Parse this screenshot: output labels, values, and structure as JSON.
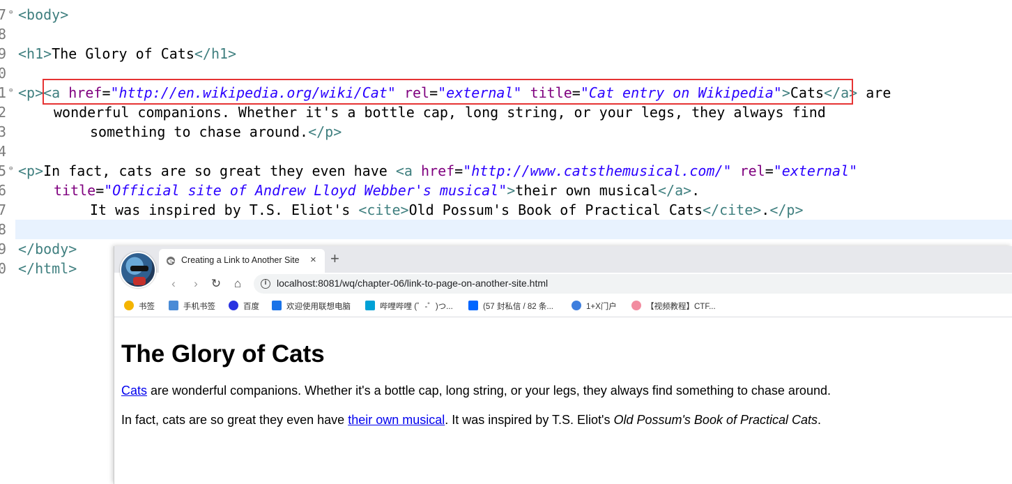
{
  "editor": {
    "gutter": [
      "7",
      "8",
      "9",
      "0",
      "1",
      "2",
      "3",
      "4",
      "5",
      "6",
      "7",
      "8",
      "9",
      "0"
    ],
    "line7": {
      "open": "<",
      "tag": "body",
      "close": ">"
    },
    "line9": {
      "open": "<h1>",
      "text": "The Glory of Cats",
      "close": "</h1>"
    },
    "line11": {
      "p_open": "<p>",
      "a_open": "<a",
      "attr_href": "href",
      "eq": "=",
      "val_href": "\"http://en.wikipedia.org/wiki/Cat\"",
      "attr_rel": "rel",
      "val_rel": "\"external\"",
      "attr_title": "title",
      "val_title": "\"Cat entry on Wikipedia\"",
      "gt": ">",
      "link_text": "Cats",
      "a_close": "</a>",
      "after": " are"
    },
    "line12": "wonderful companions. Whether it's a bottle cap, long string, or your legs, they always find",
    "line13": {
      "text": "something to chase around.",
      "close": "</p>"
    },
    "line15": {
      "p_open": "<p>",
      "text": "In fact, cats are so great they even have ",
      "a_open": "<a",
      "attr_href": "href",
      "val_href": "\"http://www.catsthemusical.com/\"",
      "attr_rel": "rel",
      "val_rel": "\"external\""
    },
    "line16": {
      "attr_title": "title",
      "val_title": "\"Official site of Andrew Lloyd Webber's musical\"",
      "gt": ">",
      "link_text": "their own musical",
      "a_close": "</a>",
      "after": "."
    },
    "line17": {
      "text": "It was inspired by T.S. Eliot's ",
      "cite_open": "<cite>",
      "cite_text": "Old Possum's Book of Practical Cats",
      "cite_close": "</cite>",
      "dot": ".",
      "p_close": "</p>"
    },
    "line19": "</body>",
    "line20": "</html>"
  },
  "browser": {
    "tab_title": "Creating a Link to Another Site",
    "tab_close": "×",
    "new_tab": "+",
    "nav": {
      "back": "‹",
      "forward": "›",
      "reload": "↻",
      "home": "⌂"
    },
    "url": "localhost:8081/wq/chapter-06/link-to-page-on-another-site.html",
    "bookmarks": [
      {
        "label": "书签",
        "icon": "star-icon",
        "color": "#f4b400"
      },
      {
        "label": "手机书签",
        "icon": "phone-bookmark-icon",
        "color": "#4a8bd6"
      },
      {
        "label": "百度",
        "icon": "baidu-paw-icon",
        "color": "#2932e1"
      },
      {
        "label": "欢迎使用联想电脑",
        "icon": "lenovo-icon",
        "color": "#1a73e8"
      },
      {
        "label": "哔哩哔哩 (゜-゜)つ...",
        "icon": "bilibili-icon",
        "color": "#00a1d6"
      },
      {
        "label": "(57 封私信 / 82 条...",
        "icon": "zhihu-icon",
        "color": "#0066ff"
      },
      {
        "label": "1+X门户",
        "icon": "portal-icon",
        "color": "#3d7ede"
      },
      {
        "label": "【视频教程】CTF...",
        "icon": "pig-icon",
        "color": "#f28ca0"
      }
    ],
    "page": {
      "h1": "The Glory of Cats",
      "p1_link": "Cats",
      "p1_rest": " are wonderful companions. Whether it's a bottle cap, long string, or your legs, they always find something to chase around.",
      "p2_start": "In fact, cats are so great they even have ",
      "p2_link": "their own musical",
      "p2_mid": ". It was inspired by T.S. Eliot's ",
      "p2_cite": "Old Possum's Book of Practical Cats",
      "p2_end": "."
    }
  }
}
